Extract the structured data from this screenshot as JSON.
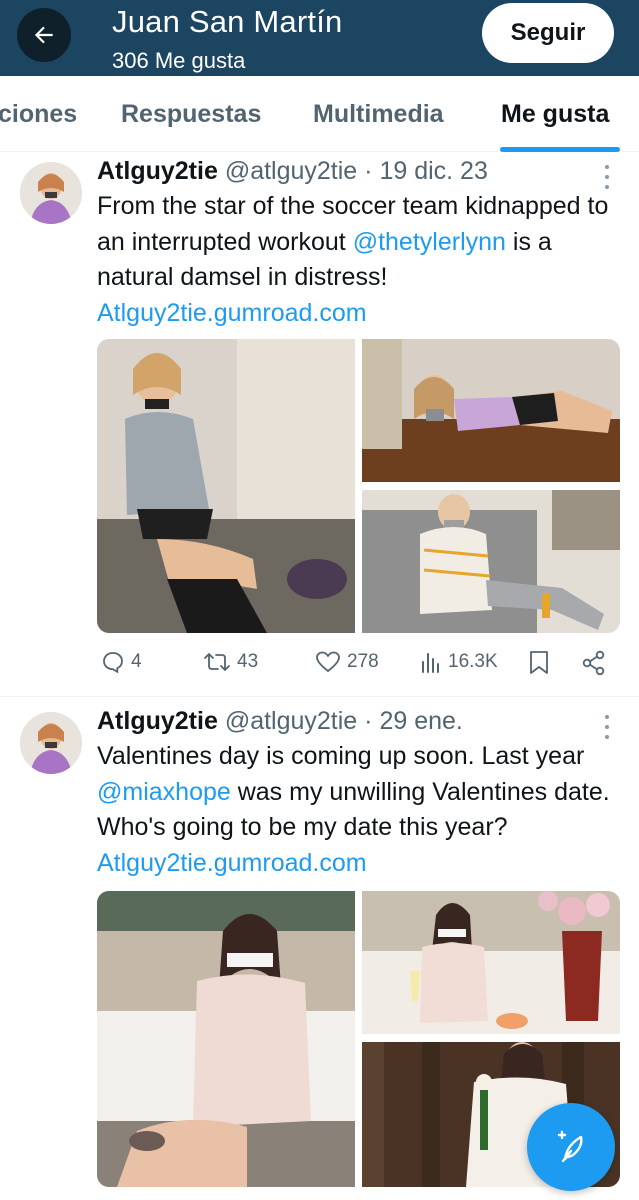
{
  "header": {
    "title": "Juan San Martín",
    "subtitle": "306 Me gusta",
    "follow_label": "Seguir",
    "back_icon": "arrow-left-icon"
  },
  "tabs": [
    {
      "label": "ciones",
      "active": false
    },
    {
      "label": "Respuestas",
      "active": false
    },
    {
      "label": "Multimedia",
      "active": false
    },
    {
      "label": "Me gusta",
      "active": true
    }
  ],
  "tweets": [
    {
      "display_name": "Atlguy2tie",
      "handle": "@atlguy2tie",
      "separator": " · ",
      "date": "19 dic. 23",
      "text_before_mention": "From the star of the soccer team kidnapped to an interrupted workout ",
      "mention": "@thetylerlynn",
      "text_after_mention": " is a natural damsel in distress!  ",
      "link": "Atlguy2tie.gumroad.com",
      "stats": {
        "replies": "4",
        "reposts": "43",
        "likes": "278",
        "views": "16.3K"
      }
    },
    {
      "display_name": "Atlguy2tie",
      "handle": "@atlguy2tie",
      "separator": " · ",
      "date": "29 ene.",
      "text_before_mention": "Valentines day is coming up soon. Last year ",
      "mention": "@miaxhope",
      "text_after_mention": " was my unwilling Valentines date. Who's going to be my date this year? ",
      "link": "Atlguy2tie.gumroad.com"
    }
  ],
  "icons": {
    "reply": "reply-icon",
    "repost": "repost-icon",
    "like": "heart-icon",
    "views": "views-icon",
    "bookmark": "bookmark-icon",
    "share": "share-icon",
    "compose": "compose-icon",
    "more": "more-icon"
  },
  "colors": {
    "header_bg": "#1b4560",
    "accent": "#1d9bf0",
    "text": "#0f1419",
    "muted": "#536471"
  }
}
